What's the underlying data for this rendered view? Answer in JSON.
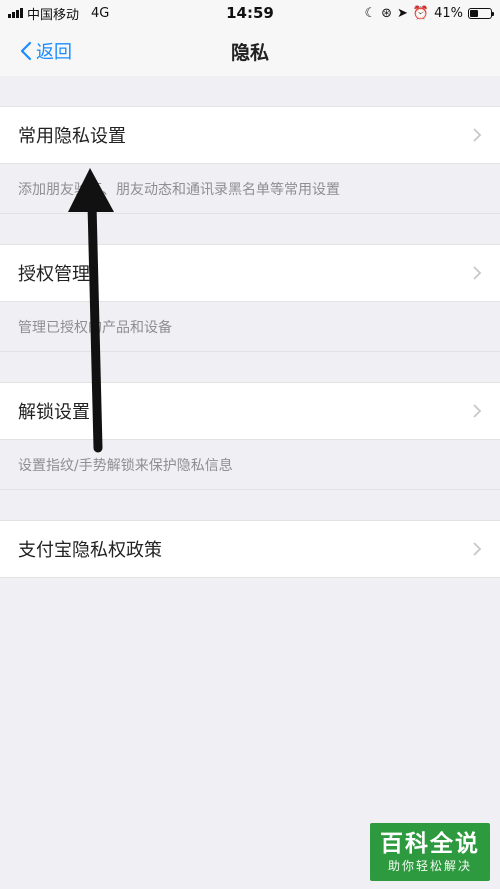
{
  "status_bar": {
    "carrier": "中国移动",
    "network": "4G",
    "time": "14:59",
    "battery": "41%",
    "battery_level": 0.41
  },
  "nav": {
    "back_label": "返回",
    "title": "隐私"
  },
  "sections": [
    {
      "label": "常用隐私设置",
      "description": "添加朋友验证、朋友动态和通讯录黑名单等常用设置"
    },
    {
      "label": "授权管理",
      "description": "管理已授权的产品和设备"
    },
    {
      "label": "解锁设置",
      "description": "设置指纹/手势解锁来保护隐私信息"
    },
    {
      "label": "支付宝隐私权政策",
      "description": ""
    }
  ],
  "watermark": {
    "main": "百科全说",
    "sub": "助你轻松解决"
  },
  "colors": {
    "accent": "#1a8cff",
    "background": "#efeff4",
    "watermark": "#2e9a3f"
  }
}
